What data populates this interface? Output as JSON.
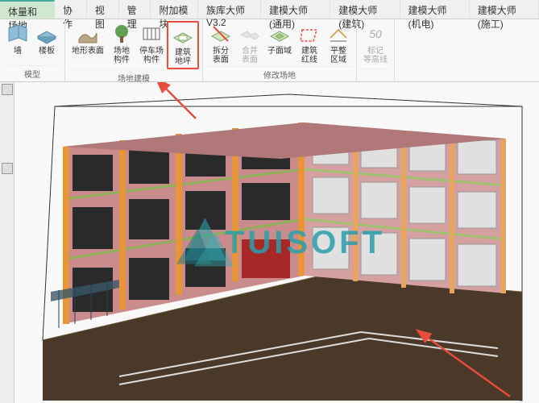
{
  "tabs": {
    "items": [
      {
        "label": "体量和场地",
        "active": true
      },
      {
        "label": "协作"
      },
      {
        "label": "视图"
      },
      {
        "label": "管理"
      },
      {
        "label": "附加模块"
      },
      {
        "label": "族库大师V3.2"
      },
      {
        "label": "建模大师 (通用)"
      },
      {
        "label": "建模大师 (建筑)"
      },
      {
        "label": "建模大师 (机电)"
      },
      {
        "label": "建模大师 (施工)"
      }
    ]
  },
  "ribbon": {
    "groups": [
      {
        "label": "模型",
        "items": [
          {
            "name": "wall",
            "label": "墙",
            "icon": "wall"
          },
          {
            "name": "floor",
            "label": "楼板",
            "icon": "floor"
          }
        ]
      },
      {
        "label": "场地建模",
        "items": [
          {
            "name": "terrain",
            "label": "地形表面",
            "icon": "terrain"
          },
          {
            "name": "site-component",
            "label": "场地\n构件",
            "icon": "tree"
          },
          {
            "name": "parking",
            "label": "停车场\n构件",
            "icon": "parking"
          },
          {
            "name": "building-pad",
            "label": "建筑\n地坪",
            "icon": "pad",
            "highlighted": true
          }
        ]
      },
      {
        "label": "修改场地",
        "items": [
          {
            "name": "split-surface",
            "label": "拆分\n表面",
            "icon": "split"
          },
          {
            "name": "merge",
            "label": "合并\n表面",
            "icon": "merge",
            "disabled": true
          },
          {
            "name": "subregion",
            "label": "子面域",
            "icon": "subregion"
          },
          {
            "name": "property-line",
            "label": "建筑\n红线",
            "icon": "property-line"
          },
          {
            "name": "grade",
            "label": "平整\n区域",
            "icon": "grade"
          }
        ]
      },
      {
        "label": "",
        "items": [
          {
            "name": "label-contour",
            "label": "标记\n等高线",
            "icon": "contour",
            "disabled": true,
            "badge": "50"
          }
        ]
      }
    ]
  },
  "watermark": {
    "text": "TUISOFT"
  }
}
